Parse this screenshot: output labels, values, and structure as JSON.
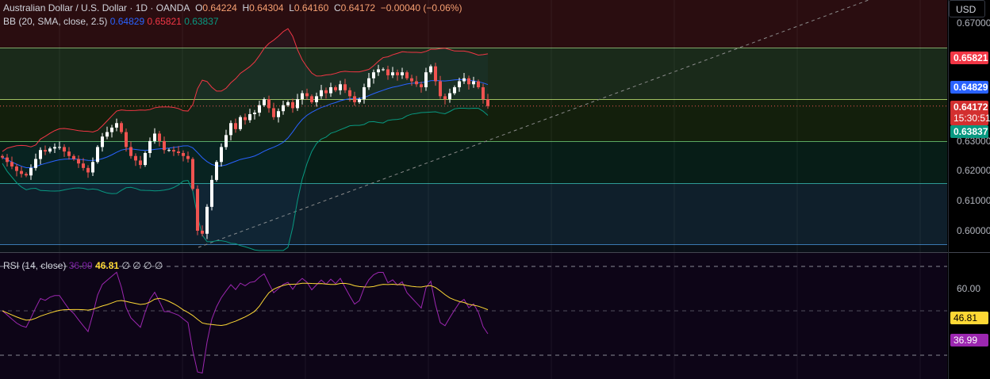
{
  "header": {
    "symbol": "Australian Dollar / U.S. Dollar · 1D · OANDA",
    "o_label": "O",
    "o": "0.64224",
    "h_label": "H",
    "h": "0.64304",
    "l_label": "L",
    "l": "0.64160",
    "c_label": "C",
    "c": "0.64172",
    "change": "−0.00040 (−0.06%)"
  },
  "bb": {
    "label": "BB (20, SMA, close, 2.5)",
    "basis": "0.64829",
    "upper": "0.65821",
    "lower": "0.63837"
  },
  "rsi": {
    "label": "RSI (14, close)",
    "value": "36.99",
    "ma": "46.81",
    "extra": "∅ ∅ ∅ ∅"
  },
  "axis": {
    "currency": "USD",
    "price_ticks": [
      "0.67000",
      "0.63000",
      "0.62000",
      "0.61000",
      "0.60000"
    ],
    "rsi_ticks": [
      "60.00"
    ],
    "countdown": "15:30:51",
    "last_price": "0.64172"
  },
  "colors": {
    "up": "#26a69a",
    "down": "#ef5350",
    "candle_up": "#ffffff",
    "basis": "#2962ff",
    "upper": "#f23645",
    "lower": "#089981",
    "rsi": "#9c27b0",
    "rsi_ma": "#fdd835"
  },
  "chart_data": {
    "type": "candlestick",
    "title": "Australian Dollar / U.S. Dollar · 1D · OANDA",
    "ylim": [
      0.593,
      0.677
    ],
    "rsi_ylim": [
      20,
      80
    ],
    "closes": [
      0.6245,
      0.623,
      0.6215,
      0.62,
      0.619,
      0.6185,
      0.621,
      0.624,
      0.627,
      0.6265,
      0.6275,
      0.628,
      0.628,
      0.6265,
      0.625,
      0.624,
      0.6225,
      0.621,
      0.6195,
      0.623,
      0.628,
      0.6315,
      0.633,
      0.6345,
      0.636,
      0.633,
      0.628,
      0.625,
      0.6235,
      0.622,
      0.626,
      0.63,
      0.6325,
      0.63,
      0.627,
      0.627,
      0.6265,
      0.626,
      0.625,
      0.624,
      0.614,
      0.6,
      0.599,
      0.608,
      0.617,
      0.623,
      0.628,
      0.632,
      0.636,
      0.634,
      0.638,
      0.637,
      0.639,
      0.6395,
      0.642,
      0.644,
      0.641,
      0.638,
      0.64,
      0.642,
      0.643,
      0.641,
      0.644,
      0.646,
      0.645,
      0.643,
      0.645,
      0.647,
      0.646,
      0.648,
      0.647,
      0.649,
      0.647,
      0.645,
      0.643,
      0.644,
      0.648,
      0.651,
      0.653,
      0.654,
      0.654,
      0.652,
      0.653,
      0.652,
      0.653,
      0.651,
      0.65,
      0.649,
      0.648,
      0.653,
      0.655,
      0.65,
      0.645,
      0.644,
      0.646,
      0.648,
      0.65,
      0.651,
      0.649,
      0.65,
      0.648,
      0.644,
      0.64172
    ]
  }
}
